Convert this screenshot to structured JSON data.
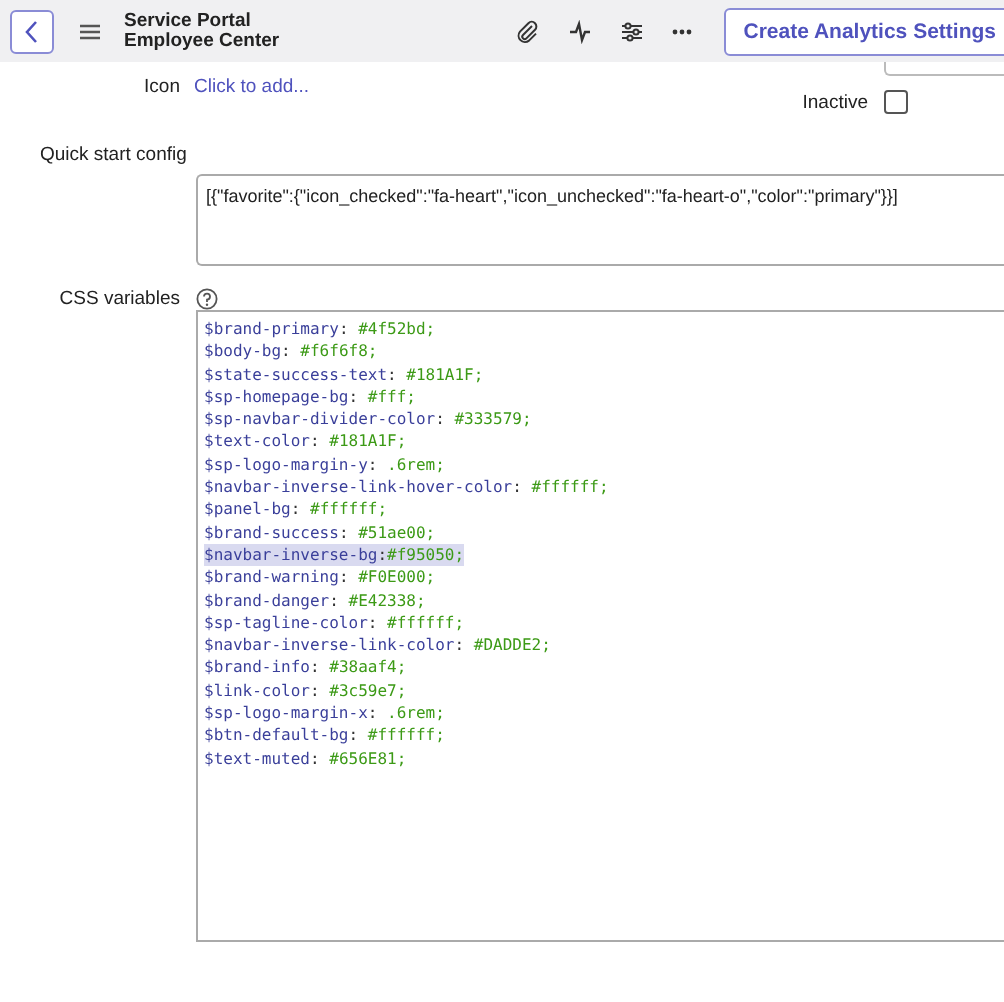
{
  "header": {
    "title_lines": [
      "Service Portal",
      "Employee Center"
    ],
    "button": "Create Analytics Settings"
  },
  "form": {
    "icon": {
      "label": "Icon",
      "link": "Click to add..."
    },
    "inactive": {
      "label": "Inactive",
      "checked": false
    },
    "quick_start": {
      "label": "Quick start config",
      "value": "[{\"favorite\":{\"icon_checked\":\"fa-heart\",\"icon_unchecked\":\"fa-heart-o\",\"color\":\"primary\"}}]"
    },
    "css_variables": {
      "label": "CSS variables",
      "lines": [
        {
          "name": "$brand-primary",
          "sep": ": ",
          "value": "#4f52bd;",
          "selected": false
        },
        {
          "name": "$body-bg",
          "sep": ": ",
          "value": "#f6f6f8;",
          "selected": false
        },
        {
          "name": "$state-success-text",
          "sep": ": ",
          "value": "#181A1F;",
          "selected": false
        },
        {
          "name": "$sp-homepage-bg",
          "sep": ": ",
          "value": "#fff;",
          "selected": false
        },
        {
          "name": "$sp-navbar-divider-color",
          "sep": ": ",
          "value": "#333579;",
          "selected": false
        },
        {
          "name": "$text-color",
          "sep": ": ",
          "value": "#181A1F;",
          "selected": false
        },
        {
          "name": "$sp-logo-margin-y",
          "sep": ": ",
          "value": ".6rem;",
          "selected": false
        },
        {
          "name": "$navbar-inverse-link-hover-color",
          "sep": ": ",
          "value": "#ffffff;",
          "selected": false
        },
        {
          "name": "$panel-bg",
          "sep": ": ",
          "value": "#ffffff;",
          "selected": false
        },
        {
          "name": "$brand-success",
          "sep": ": ",
          "value": "#51ae00;",
          "selected": false
        },
        {
          "name": "$navbar-inverse-bg",
          "sep": ":",
          "value": "#f95050;",
          "selected": true
        },
        {
          "name": "$brand-warning",
          "sep": ": ",
          "value": "#F0E000;",
          "selected": false
        },
        {
          "name": "$brand-danger",
          "sep": ": ",
          "value": "#E42338;",
          "selected": false
        },
        {
          "name": "$sp-tagline-color",
          "sep": ": ",
          "value": "#ffffff;",
          "selected": false
        },
        {
          "name": "$navbar-inverse-link-color",
          "sep": ": ",
          "value": "#DADDE2;",
          "selected": false
        },
        {
          "name": "$brand-info",
          "sep": ": ",
          "value": "#38aaf4;",
          "selected": false
        },
        {
          "name": "$link-color",
          "sep": ": ",
          "value": "#3c59e7;",
          "selected": false
        },
        {
          "name": "$sp-logo-margin-x",
          "sep": ": ",
          "value": ".6rem;",
          "selected": false
        },
        {
          "name": "$btn-default-bg",
          "sep": ": ",
          "value": "#ffffff;",
          "selected": false
        },
        {
          "name": "$text-muted",
          "sep": ": ",
          "value": "#656E81;",
          "selected": false
        }
      ]
    }
  }
}
